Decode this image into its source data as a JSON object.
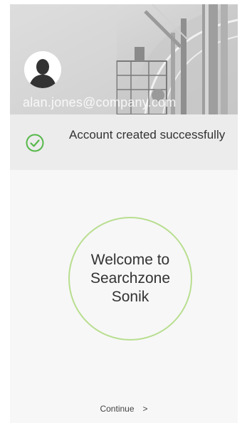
{
  "header": {
    "email": "alan.jones@company.com"
  },
  "banner": {
    "message": "Account created successfully"
  },
  "welcome": {
    "text": "Welcome to Searchzone Sonik"
  },
  "footer": {
    "continue_label": "Continue",
    "continue_chevron": ">"
  },
  "colors": {
    "success": "#56b84a",
    "welcome_ring": "#b8de8f",
    "banner_bg": "#ececec",
    "page_bg": "#f7f7f7"
  },
  "icons": {
    "avatar": "user-silhouette-icon",
    "status": "check-circle-icon"
  }
}
